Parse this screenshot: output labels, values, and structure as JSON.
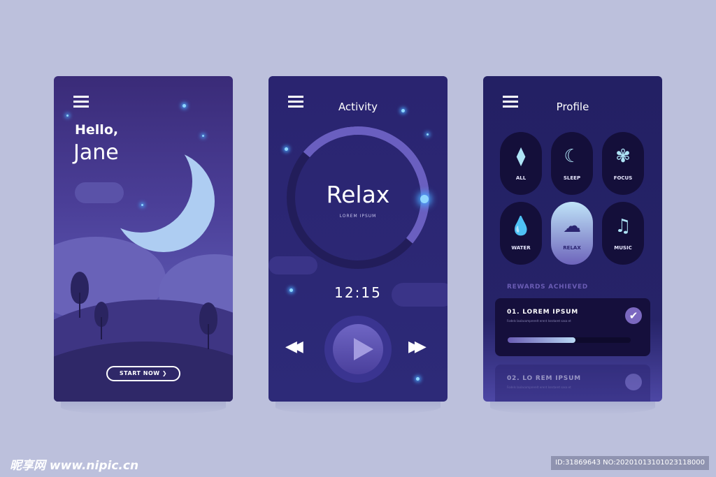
{
  "home": {
    "greeting": "Hello,",
    "name": "Jane",
    "start_button": "START NOW ❯"
  },
  "activity": {
    "title": "Activity",
    "session": "Relax",
    "subtitle": "LOREM IPSUM",
    "time": "12:15",
    "rewind": "◀◀",
    "forward": "▶▶"
  },
  "profile": {
    "title": "Profile",
    "categories": [
      {
        "label": "ALL",
        "icon": "leaf-icon",
        "glyph": "⧫"
      },
      {
        "label": "SLEEP",
        "icon": "moon-icon",
        "glyph": "☾"
      },
      {
        "label": "FOCUS",
        "icon": "brain-icon",
        "glyph": "✾"
      },
      {
        "label": "WATER",
        "icon": "water-drop-icon",
        "glyph": "💧"
      },
      {
        "label": "RELAX",
        "icon": "cloud-icon",
        "glyph": "☁"
      },
      {
        "label": "MUSIC",
        "icon": "music-icon",
        "glyph": "♫"
      }
    ],
    "active_category": "RELAX",
    "rewards_heading": "REWARDS ACHIEVED",
    "rewards": [
      {
        "title": "01. LOREM IPSUM",
        "desc": "Fodels laolacomprerelt erent Isnstaret sasa et",
        "progress": 0.55,
        "done": true
      },
      {
        "title": "02. LO REM IPSUM",
        "desc": "Fodels laolacomprerelt erent Isnstaret sasa et"
      }
    ]
  },
  "watermark": {
    "site": "昵享网 www.nipic.cn",
    "id": "ID:31869643 NO:20201013101023118000"
  },
  "colors": {
    "background": "#bcc0dc",
    "accent": "#8fd6ff",
    "card": "#150f3c"
  }
}
